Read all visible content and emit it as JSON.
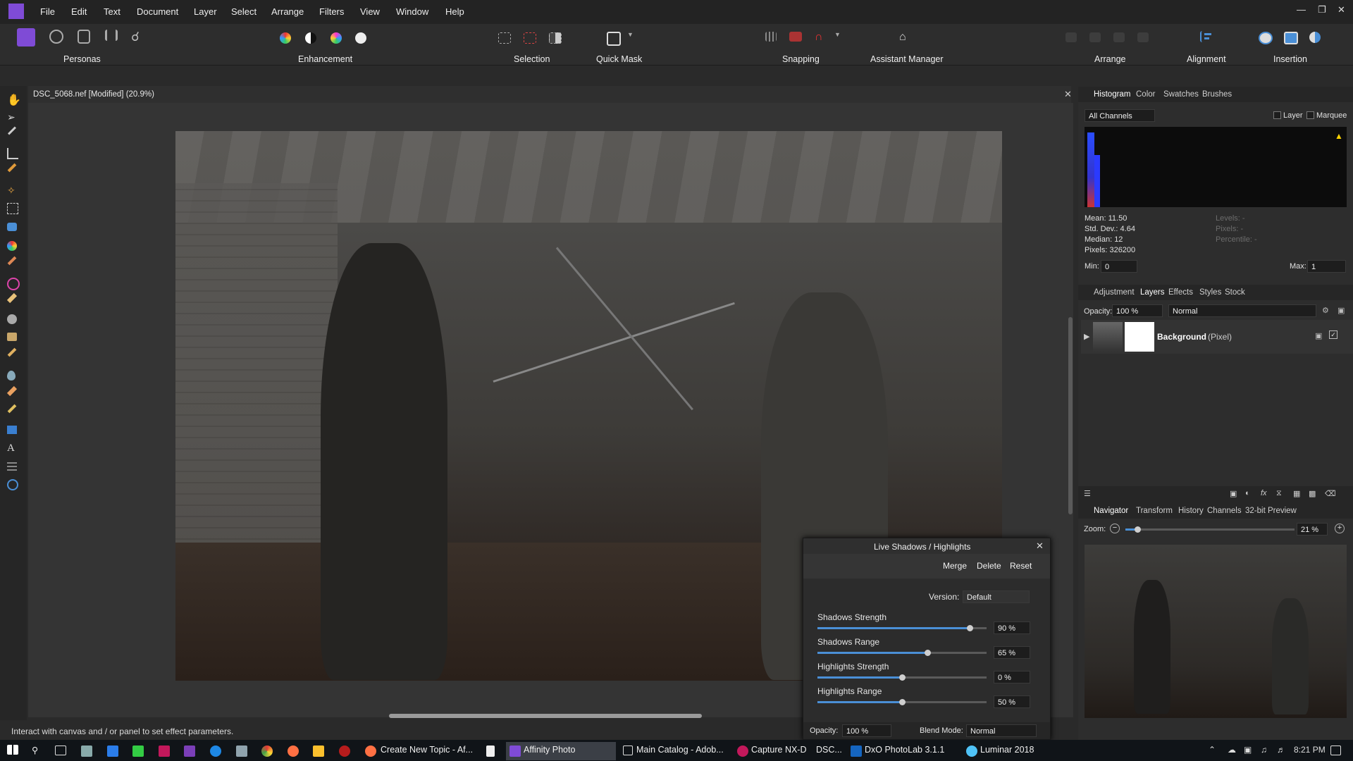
{
  "menu": [
    "File",
    "Edit",
    "Text",
    "Document",
    "Layer",
    "Select",
    "Arrange",
    "Filters",
    "View",
    "Window",
    "Help"
  ],
  "toolbar": {
    "personas": "Personas",
    "enhancement": "Enhancement",
    "selection": "Selection",
    "quick_mask": "Quick Mask",
    "snapping": "Snapping",
    "assistant": "Assistant Manager",
    "arrange": "Arrange",
    "alignment": "Alignment",
    "insertion": "Insertion"
  },
  "document": {
    "title": "DSC_5068.nef [Modified] (20.9%)"
  },
  "histogram_panel": {
    "tabs": [
      "Histogram",
      "Color",
      "Swatches",
      "Brushes"
    ],
    "channel": "All Channels",
    "layer_label": "Layer",
    "marquee_label": "Marquee",
    "stats": [
      "Mean: 11.50",
      "Std. Dev.: 4.64",
      "Median: 12",
      "Pixels: 326200"
    ],
    "stats_right": [
      "Levels: -",
      "Pixels: -",
      "Percentile: -"
    ],
    "min_label": "Min:",
    "min_value": "0",
    "max_label": "Max:",
    "max_value": "1"
  },
  "layers_panel": {
    "tabs": [
      "Adjustment",
      "Layers",
      "Effects",
      "Styles",
      "Stock"
    ],
    "opacity_label": "Opacity:",
    "opacity_value": "100 %",
    "blend": "Normal",
    "layer_name": "Background",
    "layer_type": "(Pixel)"
  },
  "navigator_panel": {
    "tabs": [
      "Navigator",
      "Transform",
      "History",
      "Channels",
      "32-bit Preview"
    ],
    "zoom_label": "Zoom:",
    "zoom_value": "21 %",
    "zoom_level": 0.07
  },
  "live_filter": {
    "title": "Live Shadows / Highlights",
    "merge": "Merge",
    "delete": "Delete",
    "reset": "Reset",
    "version_label": "Version:",
    "version_value": "Default",
    "sliders": [
      {
        "label": "Shadows Strength",
        "value": "90 %",
        "fraction": 0.9
      },
      {
        "label": "Shadows Range",
        "value": "65 %",
        "fraction": 0.65
      },
      {
        "label": "Highlights Strength",
        "value": "0 %",
        "fraction": 0.5
      },
      {
        "label": "Highlights Range",
        "value": "50 %",
        "fraction": 0.5
      }
    ],
    "opacity_label": "Opacity:",
    "opacity_value": "100 %",
    "blend_label": "Blend Mode:",
    "blend_value": "Normal"
  },
  "status_text": "Interact with canvas and / or panel to set effect parameters.",
  "taskbar": {
    "apps": [
      "Create New Topic - Af...",
      "Affinity Photo",
      "Main Catalog - Adob...",
      "Capture NX-D",
      "DSC...",
      "DxO PhotoLab 3.1.1",
      "Luminar 2018"
    ],
    "time": "8:21 PM"
  },
  "colors": {
    "accent": "#4a8fd6",
    "app_purple": "#7f4bd6"
  }
}
